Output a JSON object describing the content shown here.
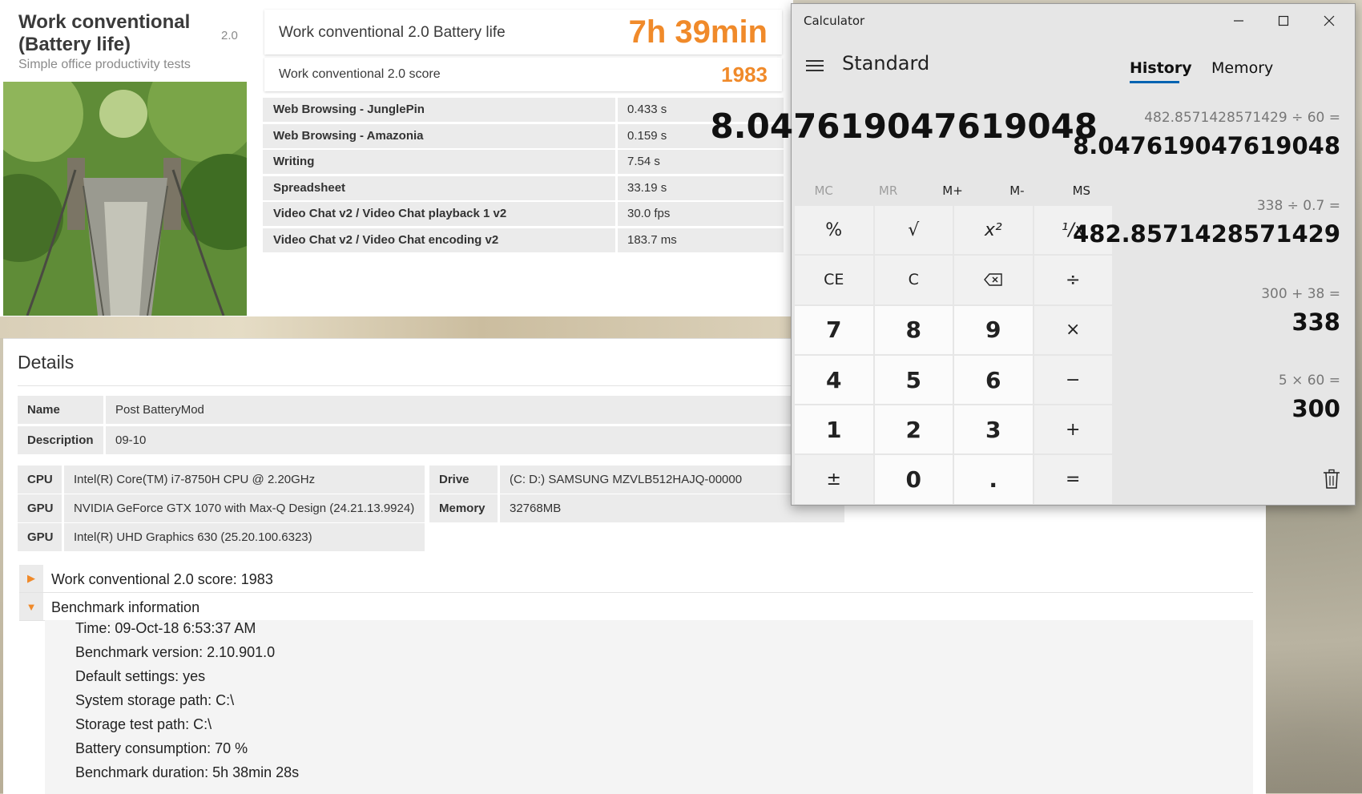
{
  "pcmark": {
    "title": "Work conventional (Battery life)",
    "version": "2.0",
    "subtitle": "Simple office productivity tests",
    "battery_label": "Work conventional 2.0 Battery life",
    "battery_value": "7h 39min",
    "score_label": "Work conventional 2.0 score",
    "score_value": "1983",
    "results": [
      {
        "name": "Web Browsing - JunglePin",
        "value": "0.433 s"
      },
      {
        "name": "Web Browsing - Amazonia",
        "value": "0.159 s"
      },
      {
        "name": "Writing",
        "value": "7.54 s"
      },
      {
        "name": "Spreadsheet",
        "value": "33.19 s"
      },
      {
        "name": "Video Chat v2 / Video Chat playback 1 v2",
        "value": "30.0 fps"
      },
      {
        "name": "Video Chat v2 / Video Chat encoding v2",
        "value": "183.7 ms"
      }
    ]
  },
  "details": {
    "title": "Details",
    "name_label": "Name",
    "name_value": "Post BatteryMod",
    "description_label": "Description",
    "description_value": "09-10",
    "cpu_label": "CPU",
    "cpu_value": "Intel(R) Core(TM) i7-8750H CPU @ 2.20GHz",
    "gpu1_label": "GPU",
    "gpu1_value": "NVIDIA GeForce GTX 1070 with Max-Q Design (24.21.13.9924)",
    "gpu2_label": "GPU",
    "gpu2_value": "Intel(R) UHD Graphics 630 (25.20.100.6323)",
    "drive_label": "Drive",
    "drive_value": "(C: D:) SAMSUNG MZVLB512HAJQ-00000",
    "memory_label": "Memory",
    "memory_value": "32768MB",
    "score_section": "Work conventional 2.0 score: 1983",
    "benchmark_section": "Benchmark information",
    "benchmark_info": [
      "Time: 09-Oct-18 6:53:37 AM",
      "Benchmark version: 2.10.901.0",
      "Default settings: yes",
      "System storage path: C:\\",
      "Storage test path: C:\\",
      "Battery consumption: 70 %",
      "Benchmark duration: 5h 38min 28s"
    ]
  },
  "calculator": {
    "window_title": "Calculator",
    "mode": "Standard",
    "display": "8.047619047619048",
    "memory_buttons": [
      "MC",
      "MR",
      "M+",
      "M-",
      "MS"
    ],
    "keys": [
      "%",
      "√",
      "x²",
      "¹/x",
      "CE",
      "C",
      "⌫",
      "÷",
      "7",
      "8",
      "9",
      "×",
      "4",
      "5",
      "6",
      "−",
      "1",
      "2",
      "3",
      "+",
      "±",
      "0",
      ".",
      "="
    ],
    "tab_history": "History",
    "tab_memory": "Memory",
    "history": [
      {
        "expr": "482.8571428571429  ÷  60 =",
        "result": "8.047619047619048"
      },
      {
        "expr": "338  ÷  0.7 =",
        "result": "482.8571428571429"
      },
      {
        "expr": "300  +  38 =",
        "result": "338"
      },
      {
        "expr": "5  ×  60 =",
        "result": "300"
      }
    ],
    "icons": {
      "menu": "hamburger-icon",
      "minimize": "minimize-icon",
      "maximize": "maximize-icon",
      "close": "close-icon",
      "delete_history": "trash-icon",
      "backspace": "backspace-icon"
    }
  }
}
